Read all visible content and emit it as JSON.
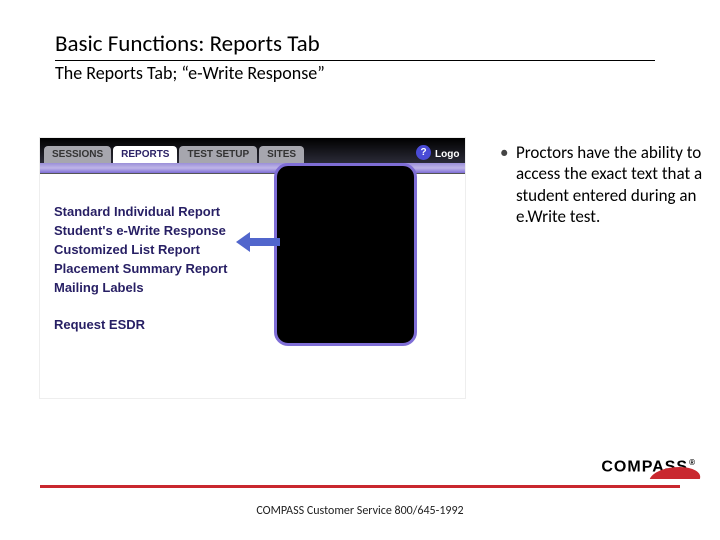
{
  "title": "Basic Functions: Reports Tab",
  "subtitle": "The Reports Tab; “e-Write Response”",
  "app": {
    "tabs": {
      "sessions": "SESSIONS",
      "reports": "REPORTS",
      "test_setup": "TEST SETUP",
      "sites": "SITES"
    },
    "help": "?",
    "logoff": "Logo",
    "reports": {
      "standard": "Standard Individual Report",
      "ewrite": "Student's e-Write Response",
      "customized": "Customized List Report",
      "placement": "Placement Summary Report",
      "mailing": "Mailing Labels",
      "esdr": "Request ESDR"
    }
  },
  "bullet": "Proctors have the ability to access the exact text that a student entered during an e.Write test.",
  "logo": {
    "text": "COMPASS",
    "reg": "®"
  },
  "footer": "COMPASS Customer Service 800/645-1992"
}
